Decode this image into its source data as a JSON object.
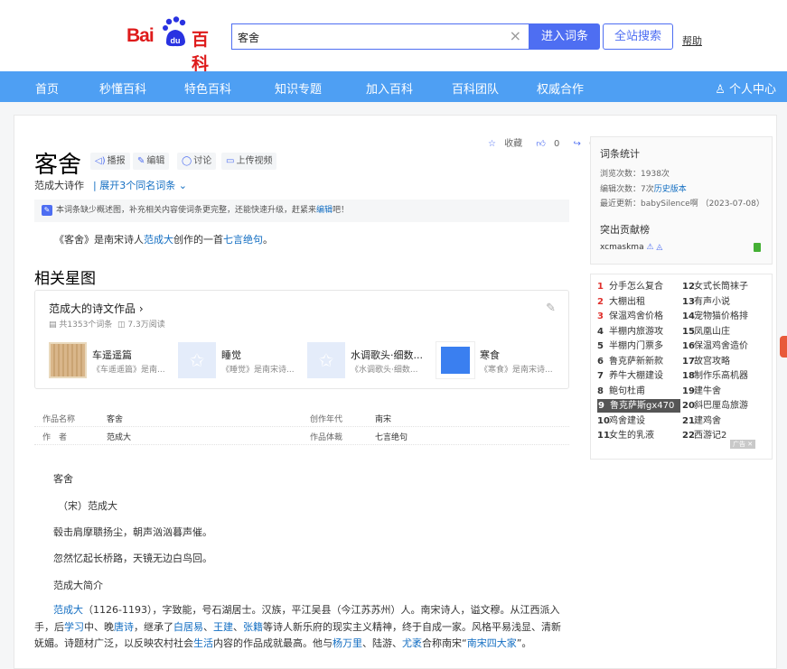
{
  "header": {
    "logo_bai": "Bai",
    "logo_du": "du",
    "logo_baike": "百科",
    "search_value": "客舍",
    "enter_button": "进入词条",
    "site_search_button": "全站搜索",
    "help": "帮助"
  },
  "nav": {
    "items": [
      "首页",
      "秒懂百科",
      "特色百科",
      "知识专题",
      "加入百科",
      "百科团队",
      "权威合作"
    ],
    "user_center": "个人中心"
  },
  "entry": {
    "title": "客舍",
    "tools": [
      "播报",
      "编辑",
      "讨论",
      "上传视频"
    ],
    "subtitle": "范成大诗作",
    "polysemy": "展开3个同名词条",
    "favorite": "收藏",
    "likes": "0",
    "shares": "0",
    "notice_text": "本词条缺少概述图，补充相关内容使词条更完整，还能快速升级，赶紧来",
    "notice_link": "编辑",
    "notice_suffix": "吧！",
    "summary_pre": "《客舍》是南宋诗人",
    "summary_poet": "范成大",
    "summary_mid": "创作的一首",
    "summary_form": "七言绝句",
    "summary_end": "。"
  },
  "related": {
    "heading": "相关星图",
    "card_title": "范成大的诗文作品",
    "entries_count": "共1353个词条",
    "reads": "7.3万阅读",
    "items": [
      {
        "name": "车遥遥篇",
        "desc": "《车遥遥篇》是南..."
      },
      {
        "name": "睡觉",
        "desc": "《睡觉》是南宋诗..."
      },
      {
        "name": "水调歌头·细数...",
        "desc": "《水调歌头·细数..."
      },
      {
        "name": "寒食",
        "desc": "《寒食》是南宋诗..."
      }
    ]
  },
  "basic_info": {
    "rows": [
      {
        "k1": "作品名称",
        "v1": "客舍",
        "k2": "创作年代",
        "v2": "南宋"
      },
      {
        "k1": "作　者",
        "v1": "范成大",
        "k2": "作品体裁",
        "v2": "七言绝句"
      }
    ]
  },
  "content": {
    "poem_title": "客舍",
    "poem_author": "（宋）范成大",
    "line1": "毂击肩摩聩扬尘，朝声汹汹暮声催。",
    "line2": "忽然忆起长桥路，天镜无边白鸟回。",
    "intro_heading": "范成大简介",
    "intro_parts": [
      {
        "t": "范成大",
        "link": true
      },
      {
        "t": "（1126-1193），字致能，号石湖居士。汉族，平江吴县（今江苏苏州）人。南宋诗人，谥文穆。从江西派入手，后",
        "link": false
      },
      {
        "t": "学习",
        "link": true
      },
      {
        "t": "中、晚",
        "link": false
      },
      {
        "t": "唐诗",
        "link": true
      },
      {
        "t": "，继承了",
        "link": false
      },
      {
        "t": "白居易",
        "link": true
      },
      {
        "t": "、",
        "link": false
      },
      {
        "t": "王建",
        "link": true
      },
      {
        "t": "、",
        "link": false
      },
      {
        "t": "张籍",
        "link": true
      },
      {
        "t": "等诗人新乐府的现实主义精神，终于自成一家。风格平易浅显、清新妩媚。诗题材广泛，以反映农村社会",
        "link": false
      },
      {
        "t": "生活",
        "link": true
      },
      {
        "t": "内容的作品成就最高。他与",
        "link": false
      },
      {
        "t": "杨万里",
        "link": true
      },
      {
        "t": "、陆游、",
        "link": false
      },
      {
        "t": "尤袤",
        "link": true
      },
      {
        "t": "合称南宋“",
        "link": false
      },
      {
        "t": "南宋四大家",
        "link": true
      },
      {
        "t": "”。",
        "link": false
      }
    ]
  },
  "sidebar": {
    "stats_heading": "词条统计",
    "views_label": "浏览次数：",
    "views": "1938次",
    "edits_label": "编辑次数：",
    "edits": "7次",
    "history": "历史版本",
    "updated_label": "最近更新：",
    "updated": "babySilence啊 （2023-07-08）",
    "contrib_heading": "突出贡献榜",
    "contributor": "xcmaskma",
    "hot_left": [
      "分手怎么复合",
      "大棚出租",
      "保温鸡舍价格",
      "半棚内旅游攻",
      "半棚内门票多",
      "鲁克萨新新款",
      "养牛大棚建设",
      "鲍句杜甫",
      "鲁克萨斯gx470",
      "鸡舍建设",
      "女生的乳液"
    ],
    "hot_right": [
      "女式长筒袜子",
      "有声小说",
      "宠物猫价格排",
      "凤凰山庄",
      "保温鸡舍造价",
      "故宫攻略",
      "制作乐高机器",
      "建牛舍",
      "斜巴厘岛旅游",
      "建鸡舍",
      "西游记2"
    ],
    "ad": "广告"
  },
  "colors": {
    "nav_bg": "#4e9ff3",
    "accent": "#4e6ef2",
    "link": "#136ec2",
    "hot_red": "#e0312d"
  }
}
